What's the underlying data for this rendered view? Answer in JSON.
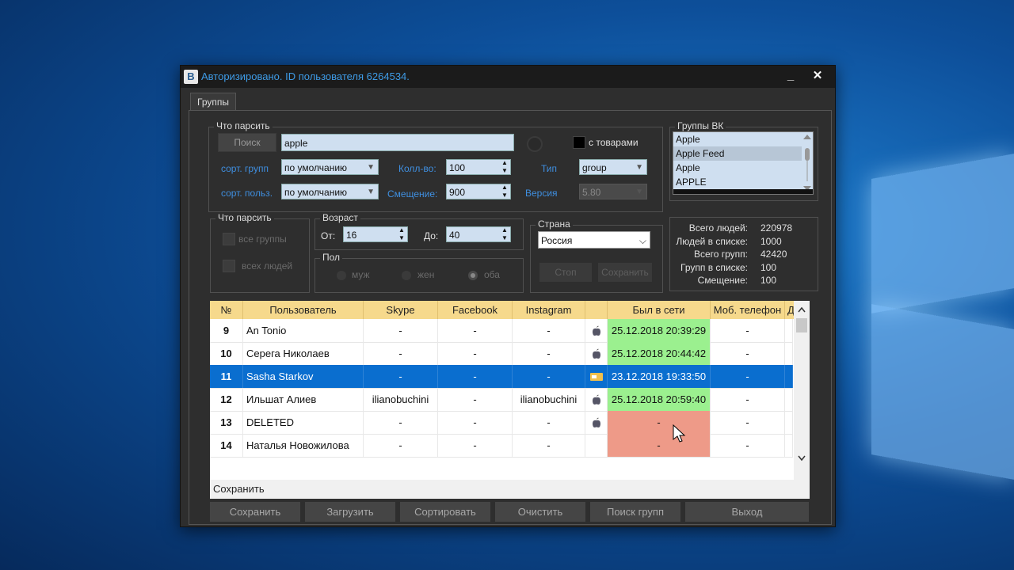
{
  "window": {
    "title": "Авторизировано. ID пользователя 6264534.",
    "logo_letter": "B",
    "minimize": "_",
    "close": "✕"
  },
  "tab": {
    "label": "Группы"
  },
  "parse": {
    "legend": "Что парсить",
    "search_button": "Поиск",
    "search_value": "apple",
    "goods_label": "с товарами",
    "sort_groups_label": "сорт. групп",
    "sort_groups_value": "по умолчанию",
    "sort_users_label": "сорт. польз.",
    "sort_users_value": "по умолчанию",
    "count_label": "Колл-во:",
    "count_value": "100",
    "offset_label": "Смещение:",
    "offset_value": "900",
    "type_label": "Тип",
    "type_value": "group",
    "version_label": "Версия",
    "version_value": "5.80"
  },
  "vk_groups": {
    "legend": "Группы ВК",
    "items": [
      "Apple",
      "Apple Feed",
      "Apple",
      "APPLE"
    ],
    "selected_index": 1
  },
  "parse2": {
    "legend": "Что парсить",
    "all_groups": "все группы",
    "all_people": "всех людей"
  },
  "age": {
    "legend": "Возраст",
    "from_label": "От:",
    "from_value": "16",
    "to_label": "До:",
    "to_value": "40"
  },
  "sex": {
    "legend": "Пол",
    "male": "муж",
    "female": "жен",
    "both": "оба"
  },
  "country": {
    "legend": "Страна",
    "value": "Россия",
    "stop": "Стоп",
    "save": "Сохранить"
  },
  "stats": [
    {
      "k": "Всего людей:",
      "v": "220978"
    },
    {
      "k": "Людей в списке:",
      "v": "1000"
    },
    {
      "k": "Всего групп:",
      "v": "42420"
    },
    {
      "k": "Групп в списке:",
      "v": "100"
    },
    {
      "k": "Смещение:",
      "v": "100"
    }
  ],
  "table": {
    "headers": [
      "№",
      "Пользователь",
      "Skype",
      "Facebook",
      "Instagram",
      "",
      "Был в сети",
      "Моб. телефон",
      "Д"
    ],
    "rows": [
      {
        "n": "9",
        "user": "An Tonio",
        "skype": "-",
        "fb": "-",
        "ig": "-",
        "dev": "apple",
        "online": "25.12.2018   20:39:29",
        "phone": "-",
        "state": "green"
      },
      {
        "n": "10",
        "user": "Серега Николаев",
        "skype": "-",
        "fb": "-",
        "ig": "-",
        "dev": "apple",
        "online": "25.12.2018   20:44:42",
        "phone": "-",
        "state": "green"
      },
      {
        "n": "11",
        "user": "Sasha Starkov",
        "skype": "-",
        "fb": "-",
        "ig": "-",
        "dev": "card",
        "online": "23.12.2018   19:33:50",
        "phone": "-",
        "state": "selected"
      },
      {
        "n": "12",
        "user": "Ильшат Алиев",
        "skype": "ilianobuchini",
        "fb": "-",
        "ig": "ilianobuchini",
        "dev": "apple",
        "online": "25.12.2018   20:59:40",
        "phone": "-",
        "state": "green"
      },
      {
        "n": "13",
        "user": "DELETED",
        "skype": "-",
        "fb": "-",
        "ig": "-",
        "dev": "apple",
        "online": "-",
        "phone": "-",
        "state": "red"
      },
      {
        "n": "14",
        "user": "Наталья Новожилова",
        "skype": "-",
        "fb": "-",
        "ig": "-",
        "dev": "",
        "online": "-",
        "phone": "-",
        "state": "red"
      }
    ]
  },
  "status": "Сохранить",
  "buttons": [
    "Сохранить",
    "Загрузить",
    "Сортировать",
    "Очистить",
    "Поиск групп",
    "Выход"
  ],
  "colors": {
    "online_green": "#9bf08f",
    "offline_red": "#ee9a88",
    "selected": "#0a6ecf",
    "header": "#f6d98c"
  }
}
